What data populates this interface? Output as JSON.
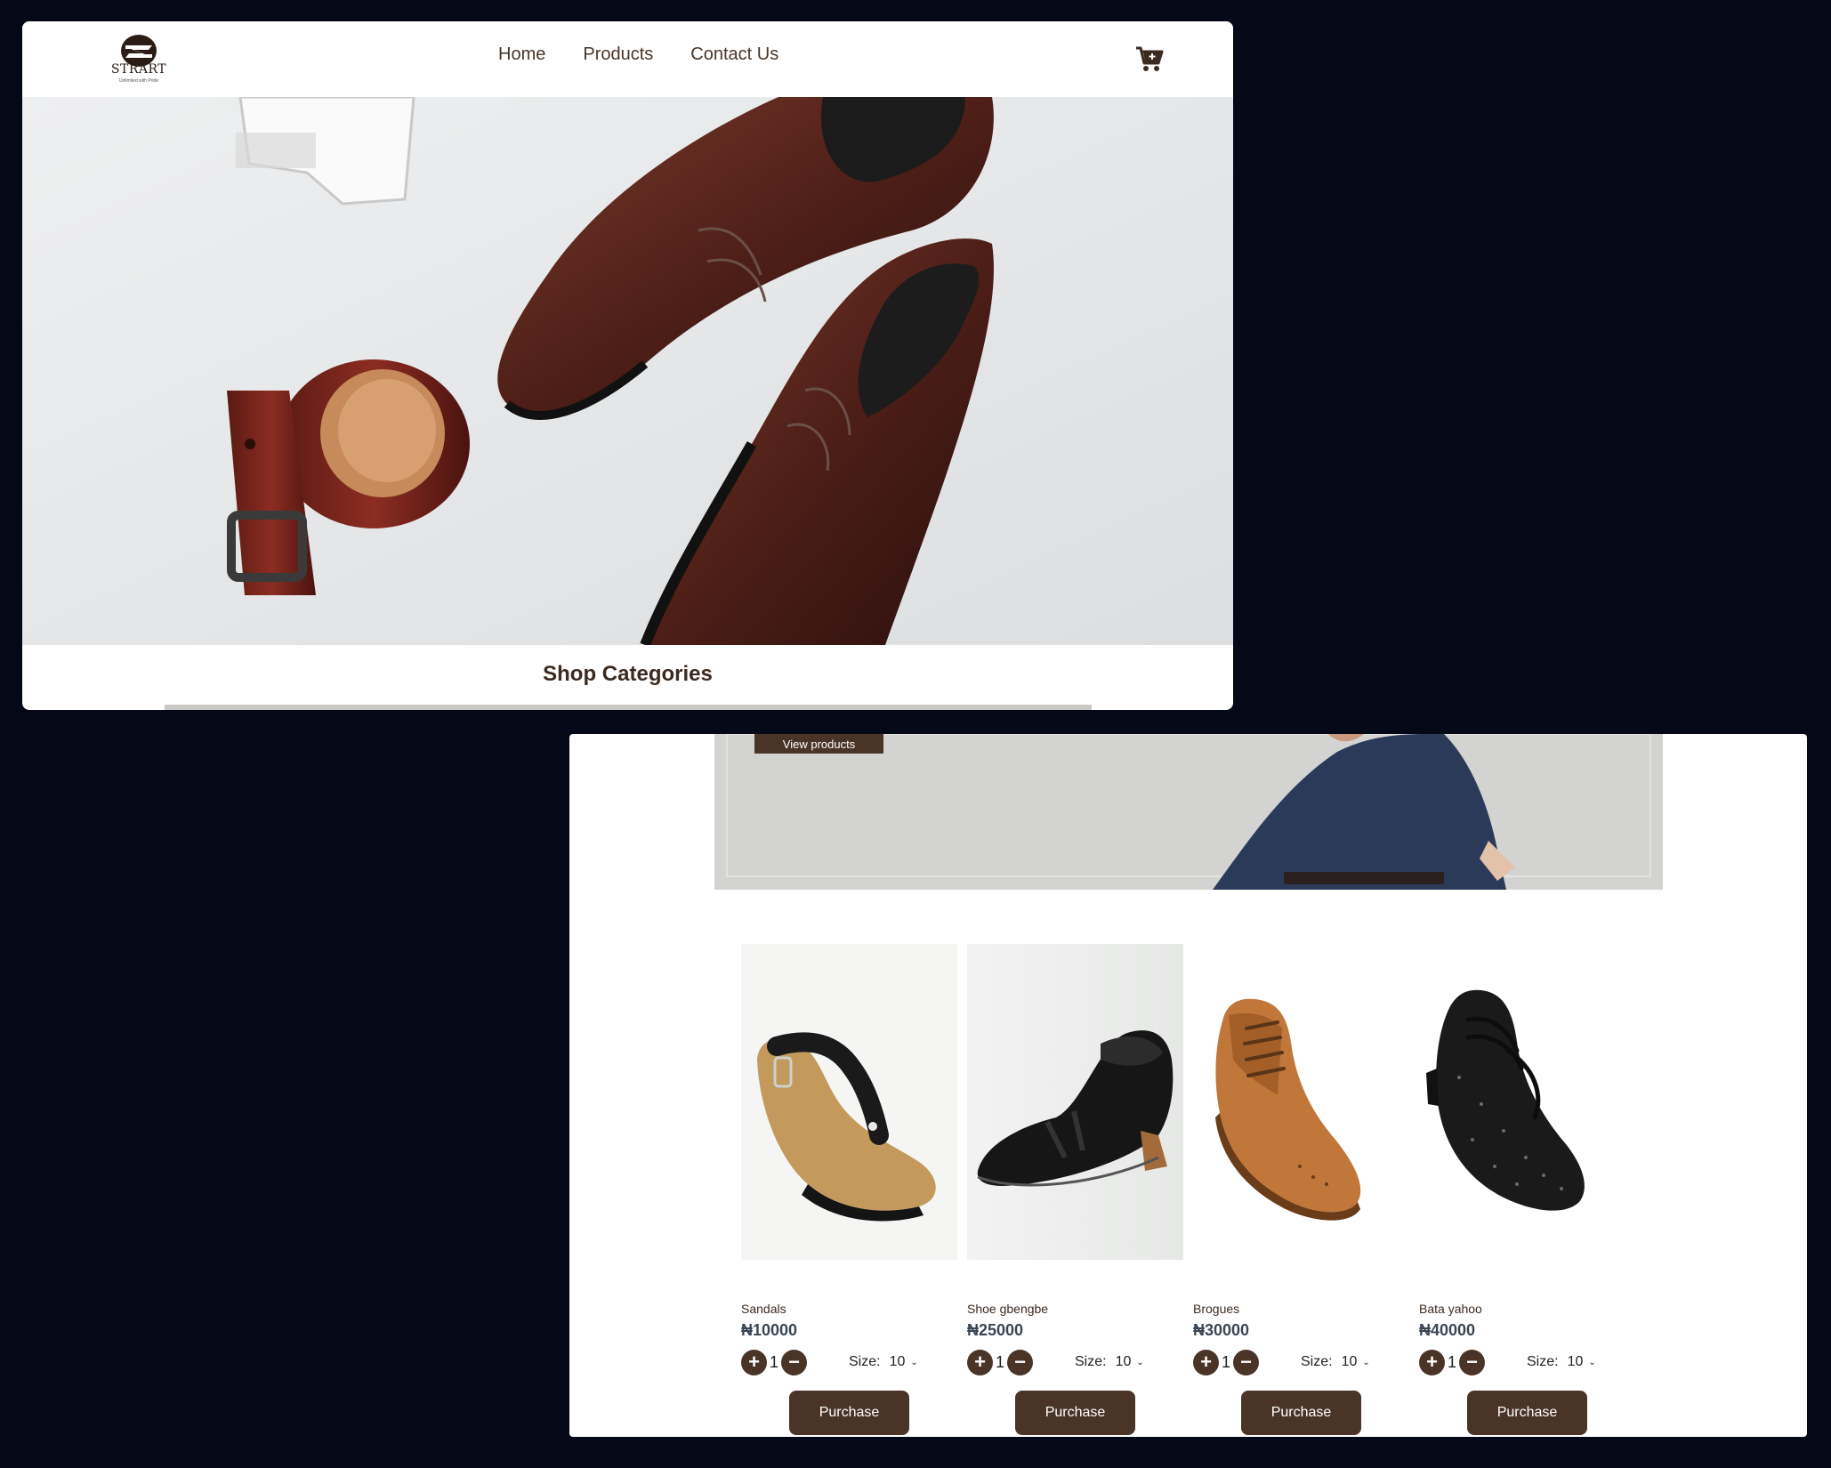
{
  "nav": {
    "logo_text": "STRART",
    "logo_tagline": "Unlimited with Pride",
    "links": [
      "Home",
      "Products",
      "Contact Us"
    ]
  },
  "hero": {
    "image": "hero-shoes-and-belt-photo"
  },
  "categories": {
    "title": "Shop Categories"
  },
  "banner": {
    "cta_label": "View products"
  },
  "products": [
    {
      "name": "Sandals",
      "price": "₦10000",
      "qty": "1",
      "size_label": "Size:",
      "size": "10",
      "button": "Purchase"
    },
    {
      "name": "Shoe gbengbe",
      "price": "₦25000",
      "qty": "1",
      "size_label": "Size:",
      "size": "10",
      "button": "Purchase"
    },
    {
      "name": "Brogues",
      "price": "₦30000",
      "qty": "1",
      "size_label": "Size:",
      "size": "10",
      "button": "Purchase"
    },
    {
      "name": "Bata yahoo",
      "price": "₦40000",
      "qty": "1",
      "size_label": "Size:",
      "size": "10",
      "button": "Purchase"
    }
  ],
  "colors": {
    "brand": "#4a3428",
    "price": "#3a4654",
    "background": "#050817"
  },
  "icons": {
    "cart": "cart-icon",
    "plus": "plus-icon",
    "minus": "minus-icon",
    "chevron": "chevron-down-icon"
  }
}
